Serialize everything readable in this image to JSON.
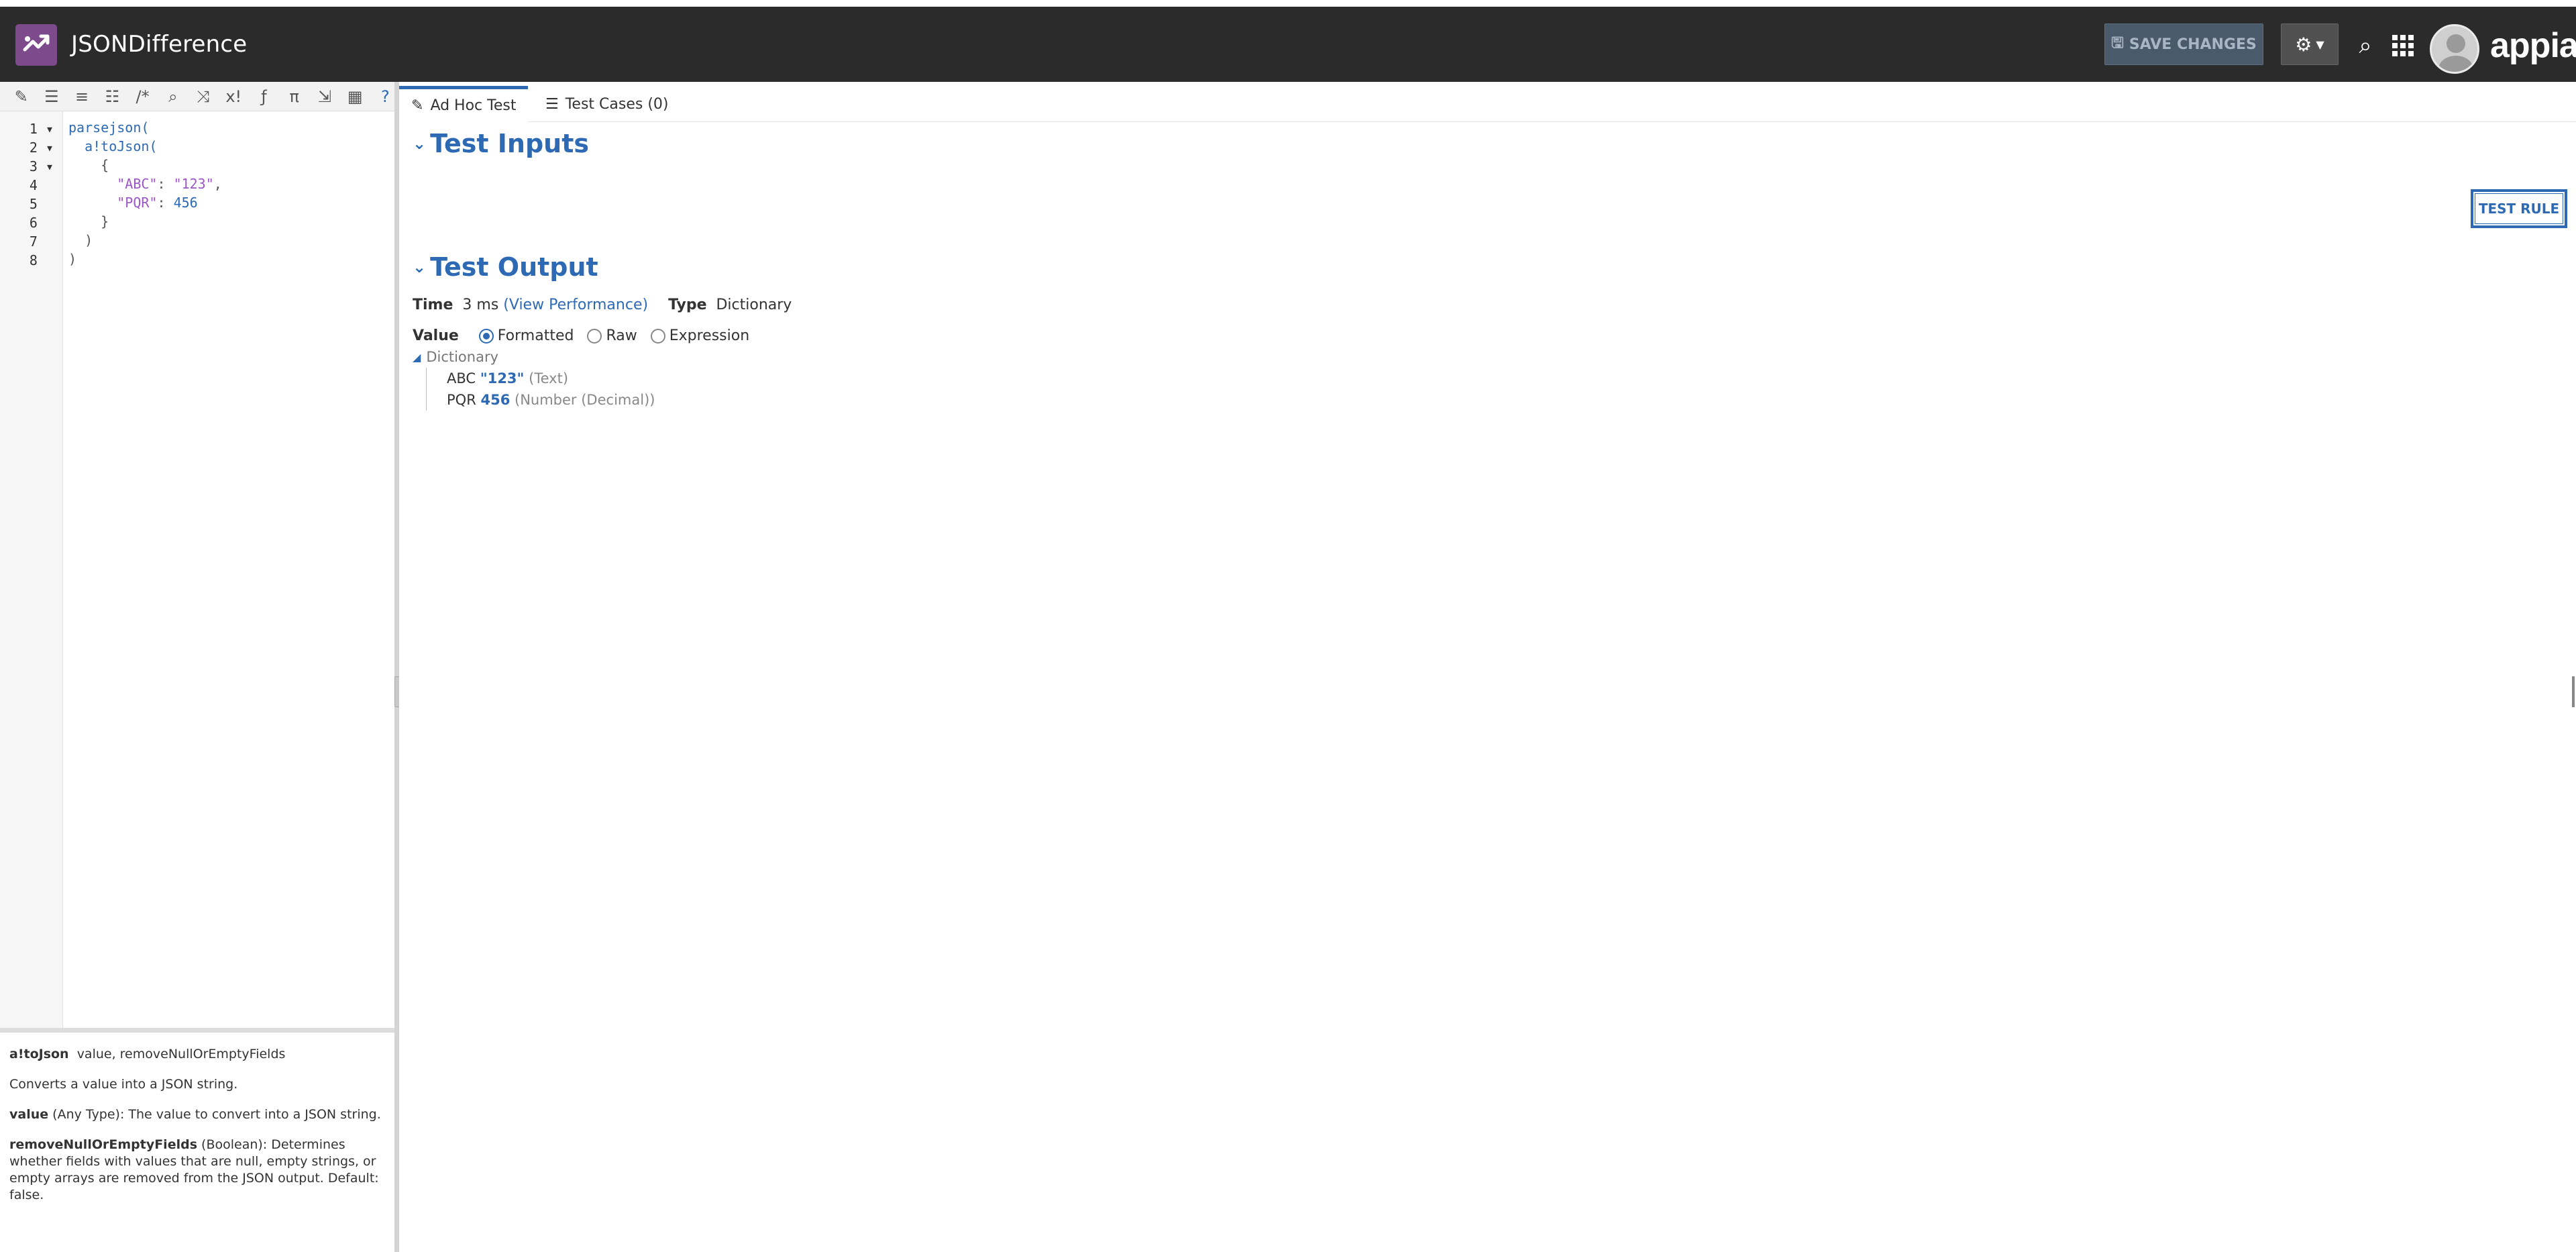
{
  "header": {
    "app_title": "JSONDifference",
    "save_label": "SAVE CHANGES",
    "brand": "appian",
    "colors": {
      "bar": "#2b2b2b",
      "logo": "#7d4a8b",
      "accent": "#2d6ab3"
    }
  },
  "toolbar": {
    "icons": [
      "magic-wand-icon",
      "indent-icon",
      "outdent-icon",
      "list-icon",
      "comment-icon",
      "search-icon",
      "shuffle-icon",
      "x-factorial-icon",
      "function-icon",
      "pi-icon",
      "export-icon",
      "calculator-icon",
      "help-icon"
    ]
  },
  "editor": {
    "lines": [
      {
        "num": "1",
        "fold": true
      },
      {
        "num": "2",
        "fold": true
      },
      {
        "num": "3",
        "fold": true
      },
      {
        "num": "4",
        "fold": false
      },
      {
        "num": "5",
        "fold": false
      },
      {
        "num": "6",
        "fold": false
      },
      {
        "num": "7",
        "fold": false
      },
      {
        "num": "8",
        "fold": false
      }
    ],
    "code": {
      "l1": "parsejson(",
      "l2": "a!toJson(",
      "l3": "{",
      "l4_key": "\"ABC\"",
      "l4_sep": ": ",
      "l4_val": "\"123\"",
      "l4_end": ",",
      "l5_key": "\"PQR\"",
      "l5_sep": ": ",
      "l5_val": "456",
      "l6": "}",
      "l7": ")",
      "l8": ")"
    }
  },
  "doc": {
    "fn_name": "a!toJson",
    "fn_params": "value, removeNullOrEmptyFields",
    "description": "Converts a value into a JSON string.",
    "param1_name": "value",
    "param1_desc": " (Any Type): The value to convert into a JSON string.",
    "param2_name": "removeNullOrEmptyFields",
    "param2_desc": " (Boolean): Determines whether fields with values that are null, empty strings, or empty arrays are removed from the JSON output. Default: false."
  },
  "tabs": [
    {
      "label": "Ad Hoc Test",
      "icon": "edit-icon",
      "active": true
    },
    {
      "label": "Test Cases (0)",
      "icon": "list-icon",
      "active": false
    }
  ],
  "test_inputs": {
    "title": "Test Inputs"
  },
  "test_rule_label": "TEST RULE",
  "test_output": {
    "title": "Test Output",
    "time_label": "Time",
    "time_value": "3 ms",
    "view_performance": "(View Performance)",
    "type_label": "Type",
    "type_value": "Dictionary",
    "value_label": "Value",
    "radios": [
      {
        "label": "Formatted",
        "selected": true
      },
      {
        "label": "Raw",
        "selected": false
      },
      {
        "label": "Expression",
        "selected": false
      }
    ],
    "tree": {
      "root": "Dictionary",
      "items": [
        {
          "key": "ABC",
          "value": "\"123\"",
          "type": "(Text)"
        },
        {
          "key": "PQR",
          "value": "456",
          "type": "(Number (Decimal))"
        }
      ]
    }
  }
}
